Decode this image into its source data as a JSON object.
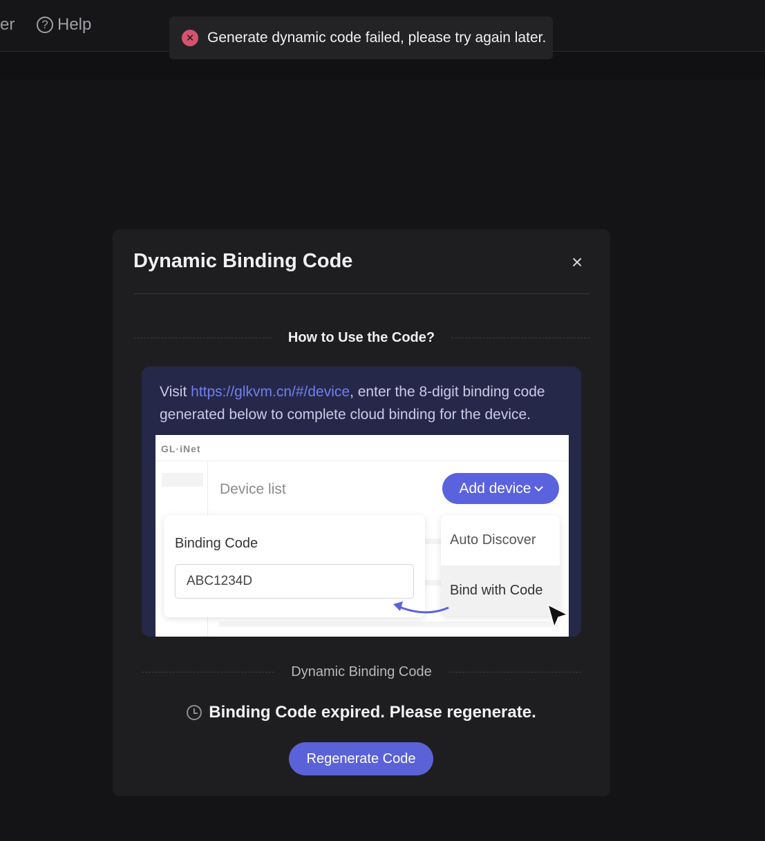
{
  "nav": {
    "partial_label": "er",
    "help_label": "Help",
    "help_icon": "question-circle-icon"
  },
  "toast": {
    "icon": "error-x-icon",
    "message": "Generate dynamic code failed, please try again later."
  },
  "modal": {
    "title": "Dynamic Binding Code",
    "close_icon": "×",
    "section1_title": "How to Use the Code?",
    "instructions": {
      "prefix": "Visit ",
      "link": "https://glkvm.cn/#/device",
      "suffix": ", enter the 8-digit binding code generated below to complete cloud binding for the device."
    },
    "illustration": {
      "brand": "GL·iNet",
      "device_list": "Device list",
      "add_device": "Add device",
      "binding_code_label": "Binding Code",
      "binding_code_value": "ABC1234D",
      "menu": [
        "Auto Discover",
        "Bind with Code"
      ]
    },
    "section2_title": "Dynamic Binding Code",
    "status": "Binding Code expired. Please regenerate.",
    "regenerate_label": "Regenerate Code"
  },
  "colors": {
    "accent": "#5b62d8",
    "error": "#d6536d",
    "link": "#6f7ff0",
    "info_bg": "#262849"
  }
}
